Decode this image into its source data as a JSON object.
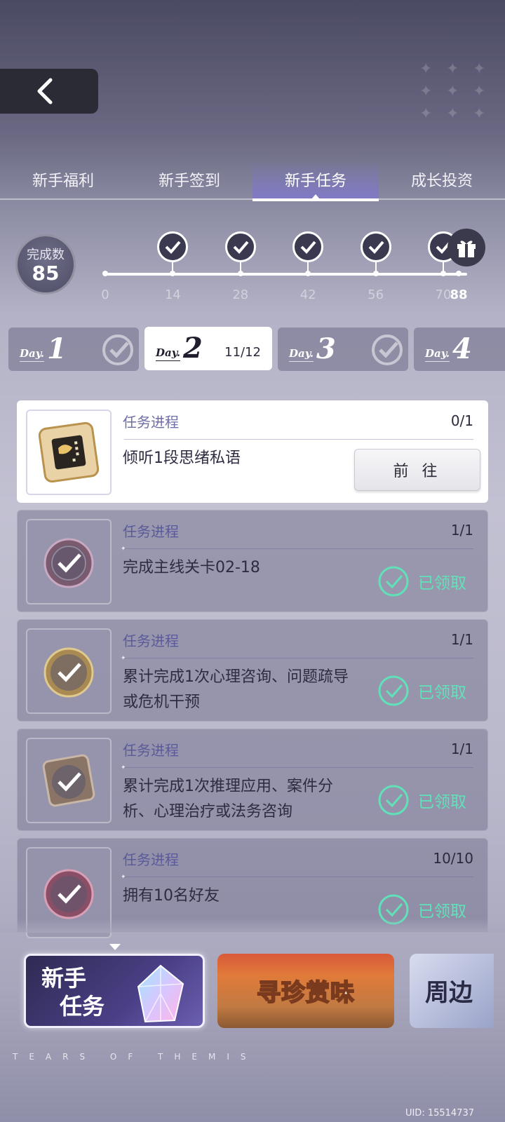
{
  "header": {
    "back_icon": "chevron-left-icon"
  },
  "tabs": [
    {
      "label": "新手福利",
      "active": false
    },
    {
      "label": "新手签到",
      "active": false
    },
    {
      "label": "新手任务",
      "active": true
    },
    {
      "label": "成长投资",
      "active": false
    }
  ],
  "progress": {
    "label": "完成数",
    "value": "85",
    "milestones": [
      "0",
      "14",
      "28",
      "42",
      "56",
      "70",
      "88"
    ],
    "completed_milestones": [
      "14",
      "28",
      "42",
      "56",
      "70"
    ],
    "final_reward_icon": "gift-icon"
  },
  "days": [
    {
      "word": "Day.",
      "num": "1",
      "count": "",
      "completed": true
    },
    {
      "word": "Day.",
      "num": "2",
      "count": "11/12",
      "completed": false,
      "active": true
    },
    {
      "word": "Day.",
      "num": "3",
      "count": "",
      "completed": true
    },
    {
      "word": "Day.",
      "num": "4",
      "count": "",
      "completed": false
    }
  ],
  "tasks": [
    {
      "header": "任务进程",
      "progress": "0/1",
      "desc": "倾听1段思绪私语",
      "action": "前 往",
      "state": "go"
    },
    {
      "header": "任务进程",
      "progress": "1/1",
      "desc": "完成主线关卡02-18",
      "action": "已领取",
      "state": "claimed"
    },
    {
      "header": "任务进程",
      "progress": "1/1",
      "desc": "累计完成1次心理咨询、问题疏导或危机干预",
      "action": "已领取",
      "state": "claimed"
    },
    {
      "header": "任务进程",
      "progress": "1/1",
      "desc": "累计完成1次推理应用、案件分析、心理治疗或法务咨询",
      "action": "已领取",
      "state": "claimed"
    },
    {
      "header": "任务进程",
      "progress": "10/10",
      "desc": "拥有10名好友",
      "action": "已领取",
      "state": "claimed"
    }
  ],
  "banners": [
    {
      "label": "新手任务",
      "active": true
    },
    {
      "label": "寻珍赏味",
      "active": false
    },
    {
      "label": "周边",
      "active": false
    }
  ],
  "footer": {
    "brand": "TEARS OF THEMIS",
    "uid": "UID: 15514737"
  },
  "colors": {
    "accent_claimed": "#5fe2b8",
    "tab_active": "#7a70e6"
  }
}
